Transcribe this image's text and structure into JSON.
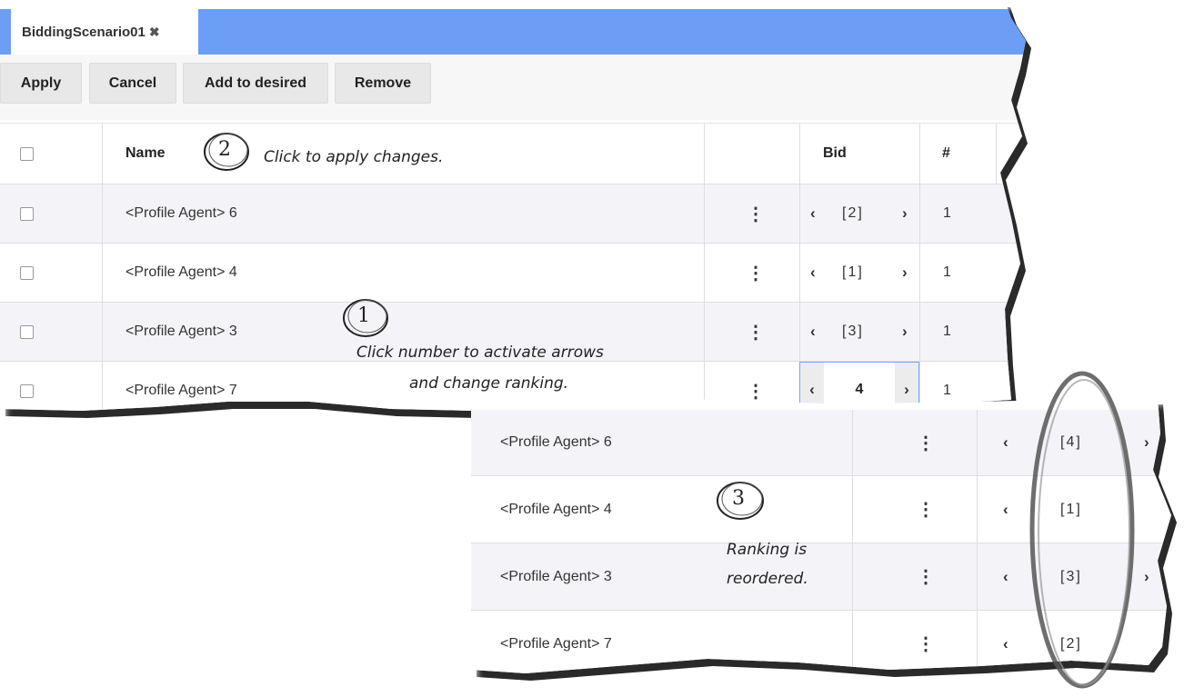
{
  "tab": {
    "title": "BiddingScenario01",
    "close_glyph": "✖"
  },
  "toolbar": {
    "apply": "Apply",
    "cancel": "Cancel",
    "add": "Add to desired",
    "remove": "Remove"
  },
  "table": {
    "headers": {
      "name": "Name",
      "bid": "Bid",
      "hash": "#"
    },
    "rows": [
      {
        "name": "<Profile Agent> 6",
        "rank": "[2]",
        "count": "1"
      },
      {
        "name": "<Profile Agent> 4",
        "rank": "[1]",
        "count": "1"
      },
      {
        "name": "<Profile Agent> 3",
        "rank": "[3]",
        "count": "1"
      },
      {
        "name": "<Profile Agent> 7",
        "rank": "4",
        "count": "1",
        "editing": true
      }
    ]
  },
  "result_table": {
    "rows": [
      {
        "name": "<Profile Agent> 6",
        "rank": "[4]"
      },
      {
        "name": "<Profile Agent> 4",
        "rank": "[1]"
      },
      {
        "name": "<Profile Agent> 3",
        "rank": "[3]"
      },
      {
        "name": "<Profile Agent> 7",
        "rank": "[2]"
      }
    ]
  },
  "annotations": {
    "step1_num": "1",
    "step1_line1": "Click number to activate arrows",
    "step1_line2": "and change ranking.",
    "step2_num": "2",
    "step2_text": "Click to apply changes.",
    "step3_num": "3",
    "step3_line1": "Ranking is",
    "step3_line2": "reordered."
  },
  "glyphs": {
    "kebab": "⋮",
    "left": "‹",
    "right": "›"
  },
  "colors": {
    "tabbar": "#6d9ef5",
    "focus_border": "#7aa6ee"
  }
}
